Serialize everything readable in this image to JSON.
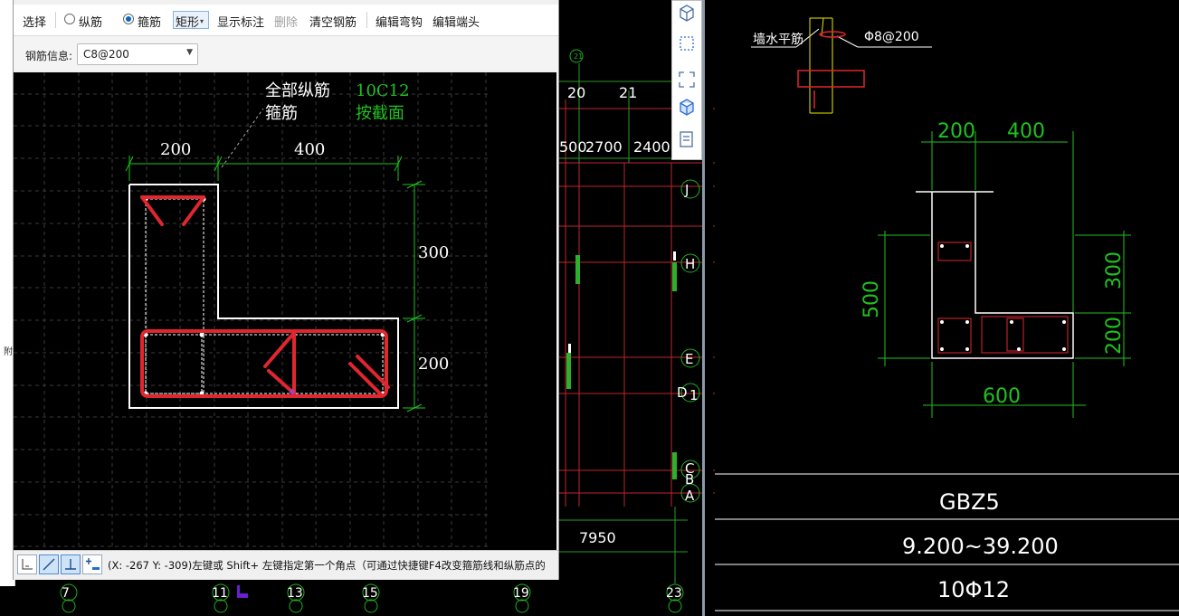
{
  "toolbar": {
    "select": "选择",
    "longitudinal": "纵筋",
    "stirrup": "箍筋",
    "shape": "矩形",
    "show_dims": "显示标注",
    "delete": "删除",
    "clear": "清空钢筋",
    "edit_hook": "编辑弯钩",
    "edit_end": "编辑端头"
  },
  "rebar_info": {
    "label": "钢筋信息:",
    "value": "C8@200"
  },
  "canvas": {
    "note_all_long": "全部纵筋",
    "note_stirrup": "箍筋",
    "note_long_val": "10C12",
    "note_stirrup_val": "按截面",
    "dim_200_top": "200",
    "dim_400_top": "400",
    "dim_300_right": "300",
    "dim_200_right": "200"
  },
  "status": {
    "text": "(X: -267 Y: -309)左键或 Shift+ 左键指定第一个角点（可通过快捷键F4改变箍筋线和纵筋点的"
  },
  "left_strip": {
    "label": "附"
  },
  "plan": {
    "axis_top": [
      "21"
    ],
    "axis_nums": [
      "20",
      "21"
    ],
    "dims": [
      "500",
      "2700",
      "2400"
    ],
    "right_axes": [
      "J",
      "H",
      "E",
      "D",
      "1",
      "C",
      "B",
      "A"
    ],
    "bottom_dim": "7950",
    "bottom_axes": [
      "7",
      "11",
      "13",
      "15",
      "19",
      "23"
    ]
  },
  "detail": {
    "wall_label": "墙水平筋",
    "spec": "Φ8@200",
    "dim_200": "200",
    "dim_400": "400",
    "dim_500": "500",
    "dim_300": "300",
    "dim_208": "200",
    "dim_600": "600",
    "name": "GBZ5",
    "elev": "9.200~39.200",
    "rebar": "10Φ12"
  },
  "colors": {
    "grid": "#3a3a3a",
    "rebar": "#e0262e",
    "dim": "#1fc21f",
    "white": "#ffffff"
  }
}
